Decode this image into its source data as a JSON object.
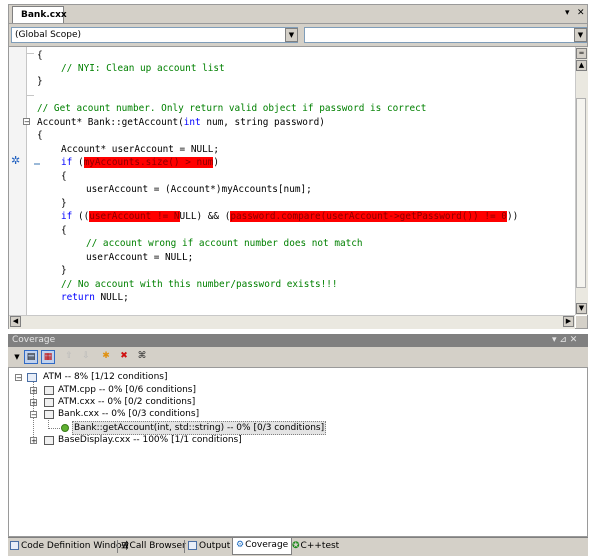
{
  "editor": {
    "tab_title": "Bank.cxx",
    "tab_dropdown_icon": "▾",
    "tab_close_icon": "✕",
    "scope_combo_value": "(Global Scope)",
    "member_combo_value": "",
    "code": {
      "l1_brace": "{",
      "l2_comment": "// NYI: Clean up account list",
      "l3_brace": "}",
      "l4_comment": "// Get acount number. Only return valid object if password is correct",
      "l5_sig": "Account* Bank::getAccount(",
      "l5_int": "int",
      "l5_rest": " num, string password)",
      "l6_brace": "{",
      "l7_decl": "Account* userAccount = NULL;",
      "l8_if": "if",
      "l8_open": " (",
      "l8_red": "myAccounts.size() > num",
      "l8_close": ")",
      "l9_brace": "{",
      "l10_stmt": "userAccount = (Account*)myAccounts[num];",
      "l11_brace": "}",
      "l12_if": "if",
      "l12_a": " ((",
      "l12_red1": "userAccount != N",
      "l12_b": "ULL) && (",
      "l12_red2": "password.compare(userAccount->getPassword()) != 0",
      "l12_c": "))",
      "l13_brace": "{",
      "l14_comment": "// account wrong if account number does not match",
      "l15_stmt": "userAccount = NULL;",
      "l16_brace": "}",
      "l17_comment": "// No account with this number/password exists!!!",
      "l18_return": "return",
      "l18_rest": " NULL;"
    }
  },
  "coverage": {
    "panel_title": "Coverage",
    "panel_controls": "▾ ⊿ ✕",
    "tree": {
      "root": "ATM -- 8% [1/12 conditions]",
      "atm_cpp": "ATM.cpp -- 0% [0/6 conditions]",
      "atm_cxx": "ATM.cxx -- 0% [0/2 conditions]",
      "bank_cxx": "Bank.cxx -- 0% [0/3 conditions]",
      "bank_get_account": "Bank::getAccount(int, std::string) -- 0% [0/3 conditions]",
      "base_display": "BaseDisplay.cxx -- 100% [1/1 conditions]"
    }
  },
  "bottom_tabs": {
    "code_definition": "Code Definition Window",
    "call_browser": "Call Browser",
    "output": "Output",
    "coverage": "Coverage",
    "cpptest": "C++test"
  },
  "colors": {
    "uncovered_highlight": "#ff0000",
    "comment": "#008000",
    "keyword": "#0000ff"
  }
}
